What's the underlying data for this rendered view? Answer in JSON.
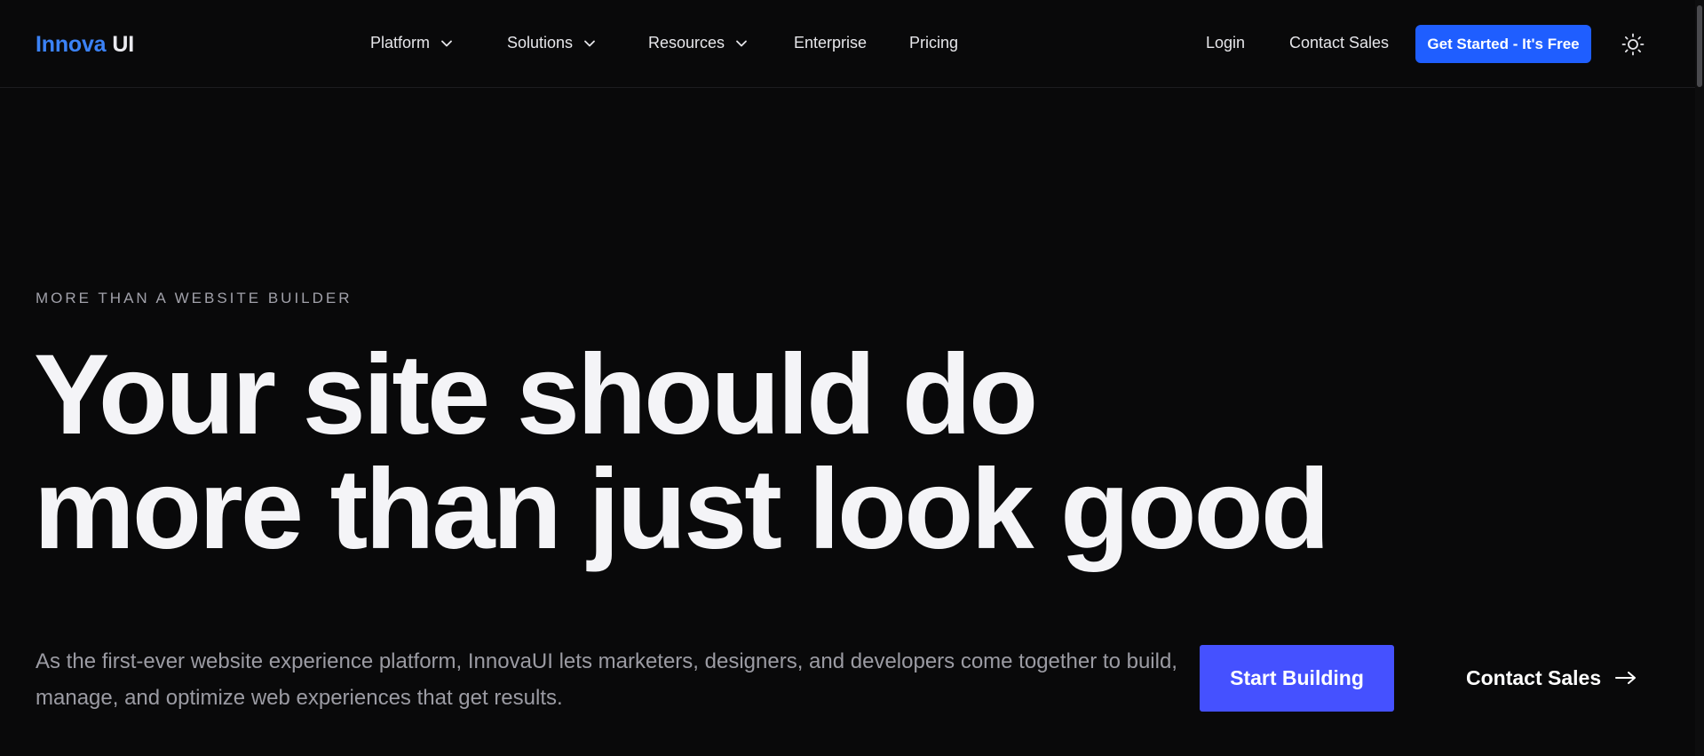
{
  "nav": {
    "logo": {
      "brand": "Innova",
      "suffix": "UI"
    },
    "menu": [
      {
        "label": "Platform",
        "has_dropdown": true
      },
      {
        "label": "Solutions",
        "has_dropdown": true
      },
      {
        "label": "Resources",
        "has_dropdown": true
      },
      {
        "label": "Enterprise",
        "has_dropdown": false
      },
      {
        "label": "Pricing",
        "has_dropdown": false
      }
    ],
    "login_label": "Login",
    "contact_label": "Contact Sales",
    "cta_label": "Get Started - It's Free",
    "theme_icon": "sun-icon"
  },
  "hero": {
    "eyebrow": "MORE THAN A WEBSITE BUILDER",
    "headline_line1": "Your site should do",
    "headline_line2": "more than just look good",
    "lede": "As the first-ever website experience platform, InnovaUI lets marketers, designers, and developers come together to build, manage, and optimize web experiences that get results.",
    "primary_cta": "Start Building",
    "secondary_cta": "Contact Sales",
    "secondary_icon": "arrow-right-icon"
  },
  "colors": {
    "background": "#09090a",
    "brand_blue": "#3b82f6",
    "nav_cta": "#1f5eff",
    "primary_cta": "#4551ff",
    "muted_text": "#9b9ba3"
  }
}
